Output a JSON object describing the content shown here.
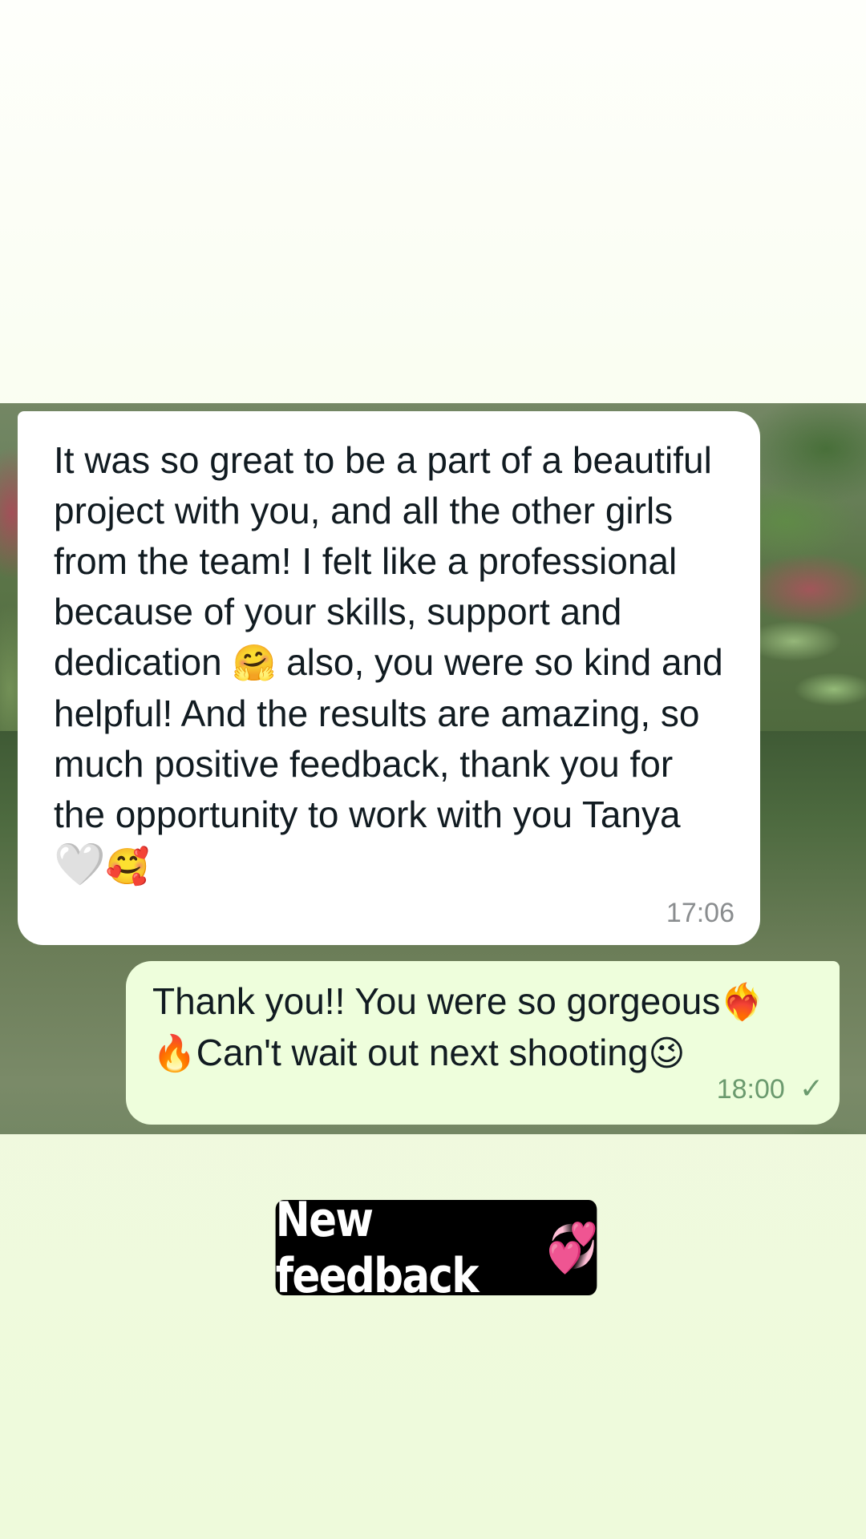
{
  "conversation": {
    "incoming": {
      "text": "It was so great to be a part of a beautiful project with you, and all the other girls from the team! I felt like a professional because of your skills, support and dedication",
      "emoji_1": "🤗",
      "text_2": "also, you were so kind and helpful! And the results are amazing, so much positive feedback, thank you for the opportunity to work with you Tanya",
      "emoji_2": "🤍",
      "emoji_3": "🥰",
      "time": "17:06"
    },
    "outgoing": {
      "text_1": "Thank you!! You were so gorgeous",
      "emoji_1": "❤️‍🔥",
      "emoji_2": "🔥",
      "text_2": "Can't wait out next shooting",
      "emoji_3": "😉",
      "time": "18:00",
      "status": "✓"
    }
  },
  "sticker": {
    "text": "New feedback",
    "emoji": "💞"
  }
}
